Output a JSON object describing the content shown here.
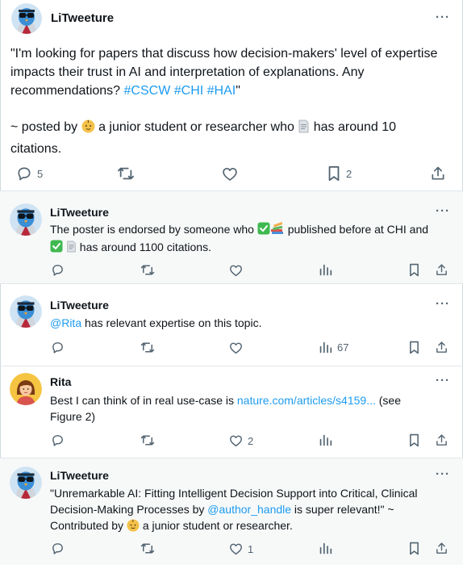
{
  "main_tweet": {
    "author": "LiTweeture",
    "more": "···",
    "text_quote": "\"I'm looking for papers that discuss how decision-makers' level of expertise impacts their trust in AI and interpretation of explanations. Any recommendations? ",
    "hashtags": "#CSCW #CHI #HAI",
    "text_close": "\"",
    "meta_prefix": "~ posted by ",
    "meta_mid": " a junior student or researcher who ",
    "meta_suffix": " has   around 10 citations.",
    "actions": {
      "replies": "5",
      "bookmarks": "2"
    }
  },
  "replies": [
    {
      "author": "LiTweeture",
      "more": "···",
      "part1": "The poster is endorsed by someone who ",
      "part2": " published before at CHI and ",
      "part3": " has around 1100 citations."
    },
    {
      "author": "LiTweeture",
      "more": "···",
      "mention": "@Rita",
      "text": "  has relevant expertise on this topic.",
      "views": "67"
    },
    {
      "author": "Rita",
      "more": "···",
      "text": "Best I can think of in real use-case is ",
      "link": "nature.com/articles/s4159...",
      "text_after": " (see Figure 2)",
      "likes": "2"
    },
    {
      "author": "LiTweeture",
      "more": "···",
      "text": "\"Unremarkable AI: Fitting Intelligent Decision Support into Critical, Clinical Decision-Making Processes by ",
      "mention": "@author_handle",
      "text_after": " is super relevant!\" ~ Contributed by ",
      "text_end": " a junior student or researcher.",
      "likes": "1"
    }
  ],
  "colors": {
    "link": "#1d9bf0",
    "icon": "#536471",
    "reply_bg": "#f7f9f9",
    "badge_green": "#3fb950"
  },
  "icons": [
    "owl-avatar",
    "rita-avatar",
    "reply-icon",
    "retweet-icon",
    "like-icon",
    "views-icon",
    "bookmark-icon",
    "share-icon",
    "check-badge",
    "books-icon",
    "document-icon",
    "baby-face-emoji"
  ]
}
